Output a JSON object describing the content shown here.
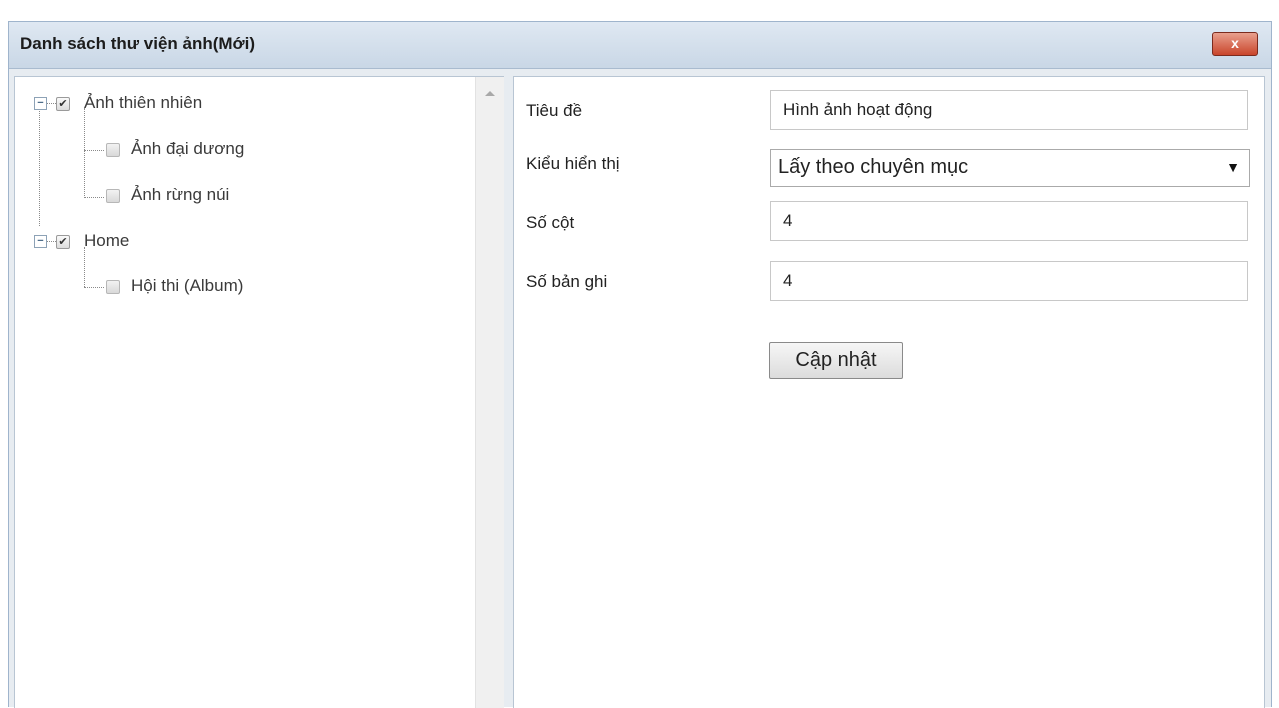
{
  "dialog": {
    "title": "Danh sách thư viện ảnh(Mới)",
    "close_label": "x"
  },
  "tree": {
    "nodes": [
      {
        "label": "Ảnh thiên nhiên",
        "checked": true,
        "expanded": true,
        "toggle": "−",
        "check_mark": "✔"
      },
      {
        "label": "Ảnh đại dương",
        "checked": false
      },
      {
        "label": "Ảnh rừng núi",
        "checked": false
      },
      {
        "label": "Home",
        "checked": true,
        "expanded": true,
        "toggle": "−",
        "check_mark": "✔"
      },
      {
        "label": "Hội thi (Album)",
        "checked": false
      }
    ]
  },
  "form": {
    "title_label": "Tiêu đề",
    "title_value": "Hình ảnh hoạt động",
    "display_label": "Kiểu hiển thị",
    "display_value": "Lấy theo chuyên mục",
    "display_arrow": "▼",
    "columns_label": "Số cột",
    "columns_value": "4",
    "records_label": "Số bản ghi",
    "records_value": "4",
    "update_label": "Cập nhật"
  },
  "colors": {
    "titlebar": "#c9d7e6",
    "close_button": "#c9452b",
    "panel_border": "#b8c5d3"
  }
}
